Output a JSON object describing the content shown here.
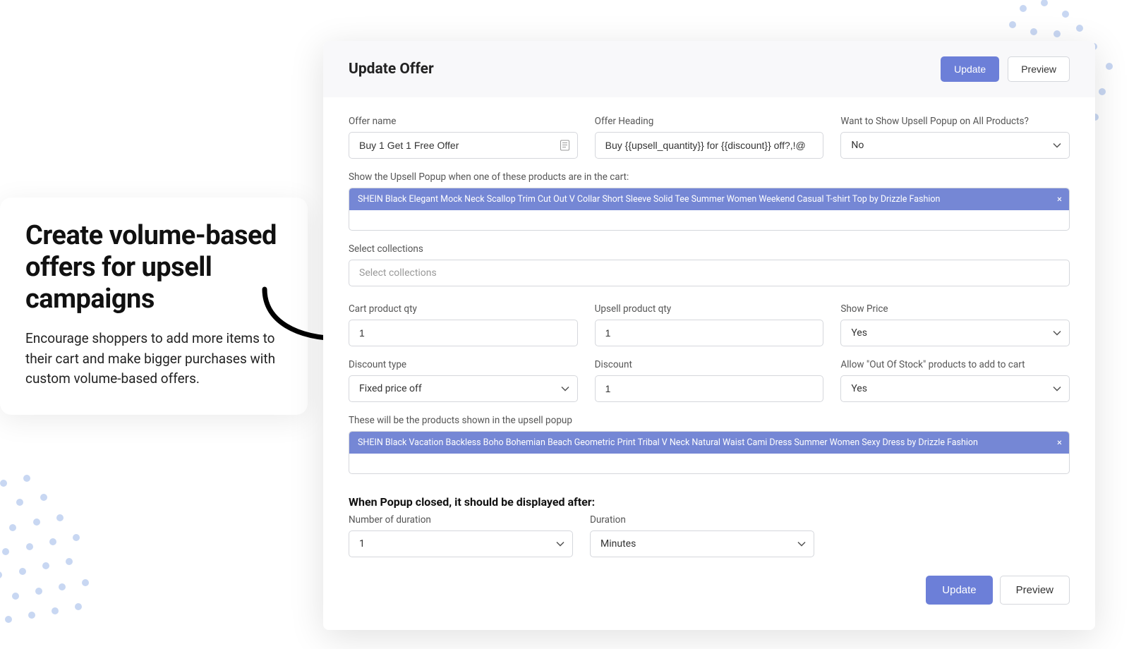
{
  "promo": {
    "title": "Create volume-based offers for upsell campaigns",
    "body": "Encourage shoppers to add more items to their cart and make bigger purchases with custom volume-based offers."
  },
  "header": {
    "title": "Update Offer",
    "update_label": "Update",
    "preview_label": "Preview"
  },
  "form": {
    "offer_name_label": "Offer name",
    "offer_name_value": "Buy 1 Get 1 Free Offer",
    "offer_heading_label": "Offer Heading",
    "offer_heading_value": "Buy {{upsell_quantity}} for {{discount}} off?,!@",
    "show_all_label": "Want to Show Upsell Popup on All Products?",
    "show_all_value": "No",
    "trigger_products_label": "Show the Upsell Popup when one of these products are in the cart:",
    "trigger_product_tag": "SHEIN Black Elegant Mock Neck Scallop Trim Cut Out V Collar Short Sleeve Solid Tee Summer Women Weekend Casual T-shirt Top by Drizzle Fashion",
    "select_collections_label": "Select collections",
    "select_collections_placeholder": "Select collections",
    "cart_qty_label": "Cart product qty",
    "cart_qty_value": "1",
    "upsell_qty_label": "Upsell product qty",
    "upsell_qty_value": "1",
    "show_price_label": "Show Price",
    "show_price_value": "Yes",
    "discount_type_label": "Discount type",
    "discount_type_value": "Fixed price off",
    "discount_label": "Discount",
    "discount_value": "1",
    "allow_oos_label": "Allow \"Out Of Stock\" products to add to cart",
    "allow_oos_value": "Yes",
    "upsell_products_label": "These will be the products shown in the upsell popup",
    "upsell_product_tag": "SHEIN Black Vacation Backless Boho Bohemian Beach Geometric Print Tribal V Neck Natural Waist Cami Dress Summer Women Sexy Dress by Drizzle Fashion",
    "popup_closed_heading": "When Popup closed, it should be displayed after:",
    "number_duration_label": "Number of duration",
    "number_duration_value": "1",
    "duration_label": "Duration",
    "duration_value": "Minutes",
    "footer_update_label": "Update",
    "footer_preview_label": "Preview"
  }
}
